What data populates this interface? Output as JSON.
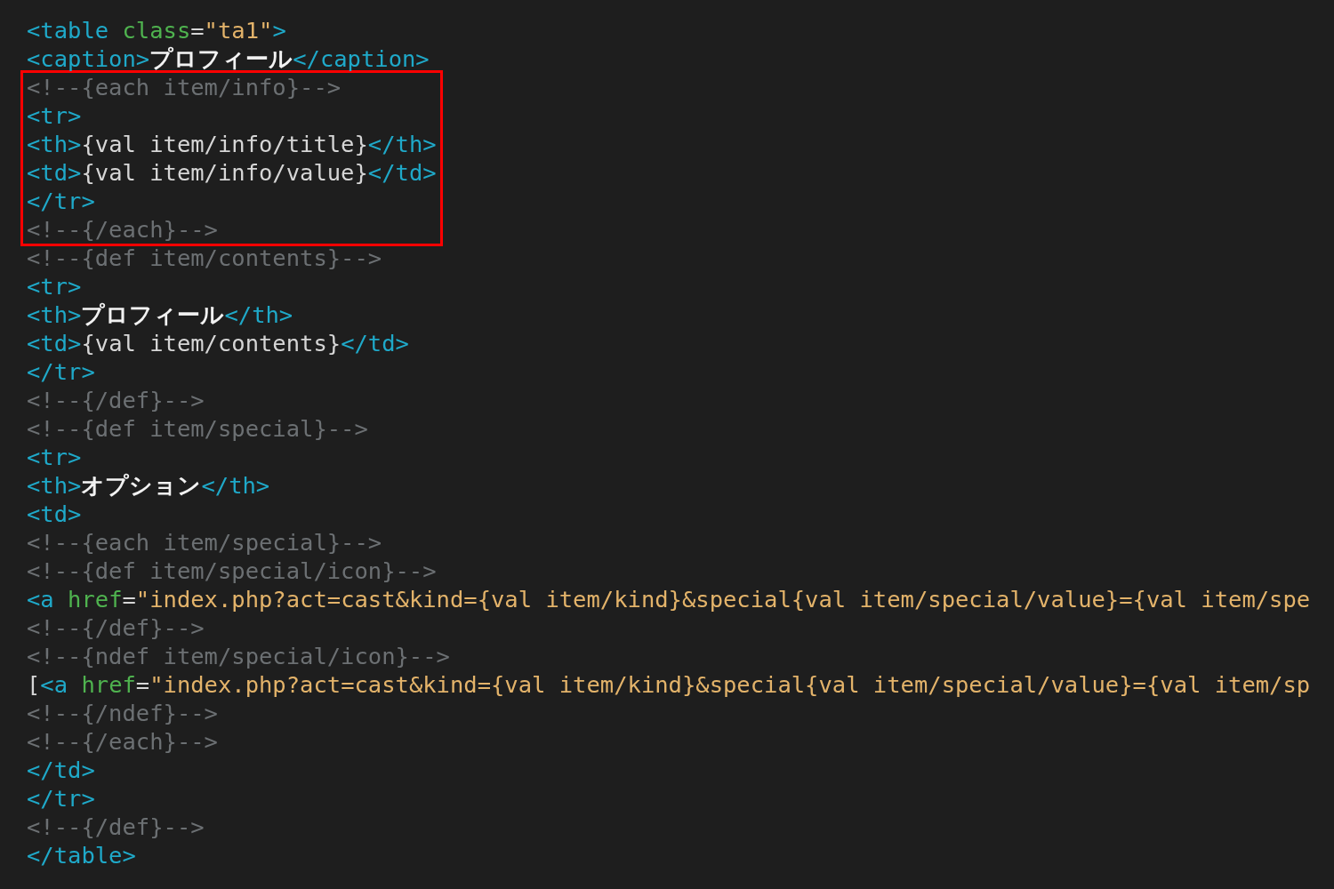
{
  "blocks": [
    {
      "highlighted": false,
      "lines": [
        [
          {
            "kind": "tag",
            "text": "<table"
          },
          {
            "kind": "attr",
            "text": " class"
          },
          {
            "kind": "text",
            "text": "="
          },
          {
            "kind": "string",
            "text": "\"ta1\""
          },
          {
            "kind": "tag",
            "text": ">"
          }
        ],
        [
          {
            "kind": "tag",
            "text": "<caption>"
          },
          {
            "kind": "bold",
            "text": "プロフィール"
          },
          {
            "kind": "tag",
            "text": "</caption>"
          }
        ]
      ]
    },
    {
      "highlighted": true,
      "lines": [
        [
          {
            "kind": "comment",
            "text": "<!--{each item/info}-->"
          }
        ],
        [
          {
            "kind": "tag",
            "text": "<tr>"
          }
        ],
        [
          {
            "kind": "tag",
            "text": "<th>"
          },
          {
            "kind": "text",
            "text": "{val item/info/title}"
          },
          {
            "kind": "tag",
            "text": "</th>"
          }
        ],
        [
          {
            "kind": "tag",
            "text": "<td>"
          },
          {
            "kind": "text",
            "text": "{val item/info/value}"
          },
          {
            "kind": "tag",
            "text": "</td>"
          }
        ],
        [
          {
            "kind": "tag",
            "text": "</tr>"
          }
        ],
        [
          {
            "kind": "comment",
            "text": "<!--{/each}-->"
          }
        ]
      ]
    },
    {
      "highlighted": false,
      "lines": [
        [
          {
            "kind": "comment",
            "text": "<!--{def item/contents}-->"
          }
        ],
        [
          {
            "kind": "tag",
            "text": "<tr>"
          }
        ],
        [
          {
            "kind": "tag",
            "text": "<th>"
          },
          {
            "kind": "bold",
            "text": "プロフィール"
          },
          {
            "kind": "tag",
            "text": "</th>"
          }
        ],
        [
          {
            "kind": "tag",
            "text": "<td>"
          },
          {
            "kind": "text",
            "text": "{val item/contents}"
          },
          {
            "kind": "tag",
            "text": "</td>"
          }
        ],
        [
          {
            "kind": "tag",
            "text": "</tr>"
          }
        ],
        [
          {
            "kind": "comment",
            "text": "<!--{/def}-->"
          }
        ],
        [
          {
            "kind": "comment",
            "text": "<!--{def item/special}-->"
          }
        ],
        [
          {
            "kind": "tag",
            "text": "<tr>"
          }
        ],
        [
          {
            "kind": "tag",
            "text": "<th>"
          },
          {
            "kind": "bold",
            "text": "オプション"
          },
          {
            "kind": "tag",
            "text": "</th>"
          }
        ],
        [
          {
            "kind": "tag",
            "text": "<td>"
          }
        ],
        [
          {
            "kind": "comment",
            "text": "<!--{each item/special}-->"
          }
        ],
        [
          {
            "kind": "comment",
            "text": "<!--{def item/special/icon}-->"
          }
        ],
        [
          {
            "kind": "tag",
            "text": "<a"
          },
          {
            "kind": "attr",
            "text": " href"
          },
          {
            "kind": "text",
            "text": "="
          },
          {
            "kind": "string",
            "text": "\"index.php?act=cast&kind={val item/kind}&special{val item/special/value}={val item/spe"
          }
        ],
        [
          {
            "kind": "comment",
            "text": "<!--{/def}-->"
          }
        ],
        [
          {
            "kind": "comment",
            "text": "<!--{ndef item/special/icon}-->"
          }
        ],
        [
          {
            "kind": "text",
            "text": "["
          },
          {
            "kind": "tag",
            "text": "<a"
          },
          {
            "kind": "attr",
            "text": " href"
          },
          {
            "kind": "text",
            "text": "="
          },
          {
            "kind": "string",
            "text": "\"index.php?act=cast&kind={val item/kind}&special{val item/special/value}={val item/sp"
          }
        ],
        [
          {
            "kind": "comment",
            "text": "<!--{/ndef}-->"
          }
        ],
        [
          {
            "kind": "comment",
            "text": "<!--{/each}-->"
          }
        ],
        [
          {
            "kind": "tag",
            "text": "</td>"
          }
        ],
        [
          {
            "kind": "tag",
            "text": "</tr>"
          }
        ],
        [
          {
            "kind": "comment",
            "text": "<!--{/def}-->"
          }
        ],
        [
          {
            "kind": "tag",
            "text": "</table>"
          }
        ]
      ]
    }
  ]
}
